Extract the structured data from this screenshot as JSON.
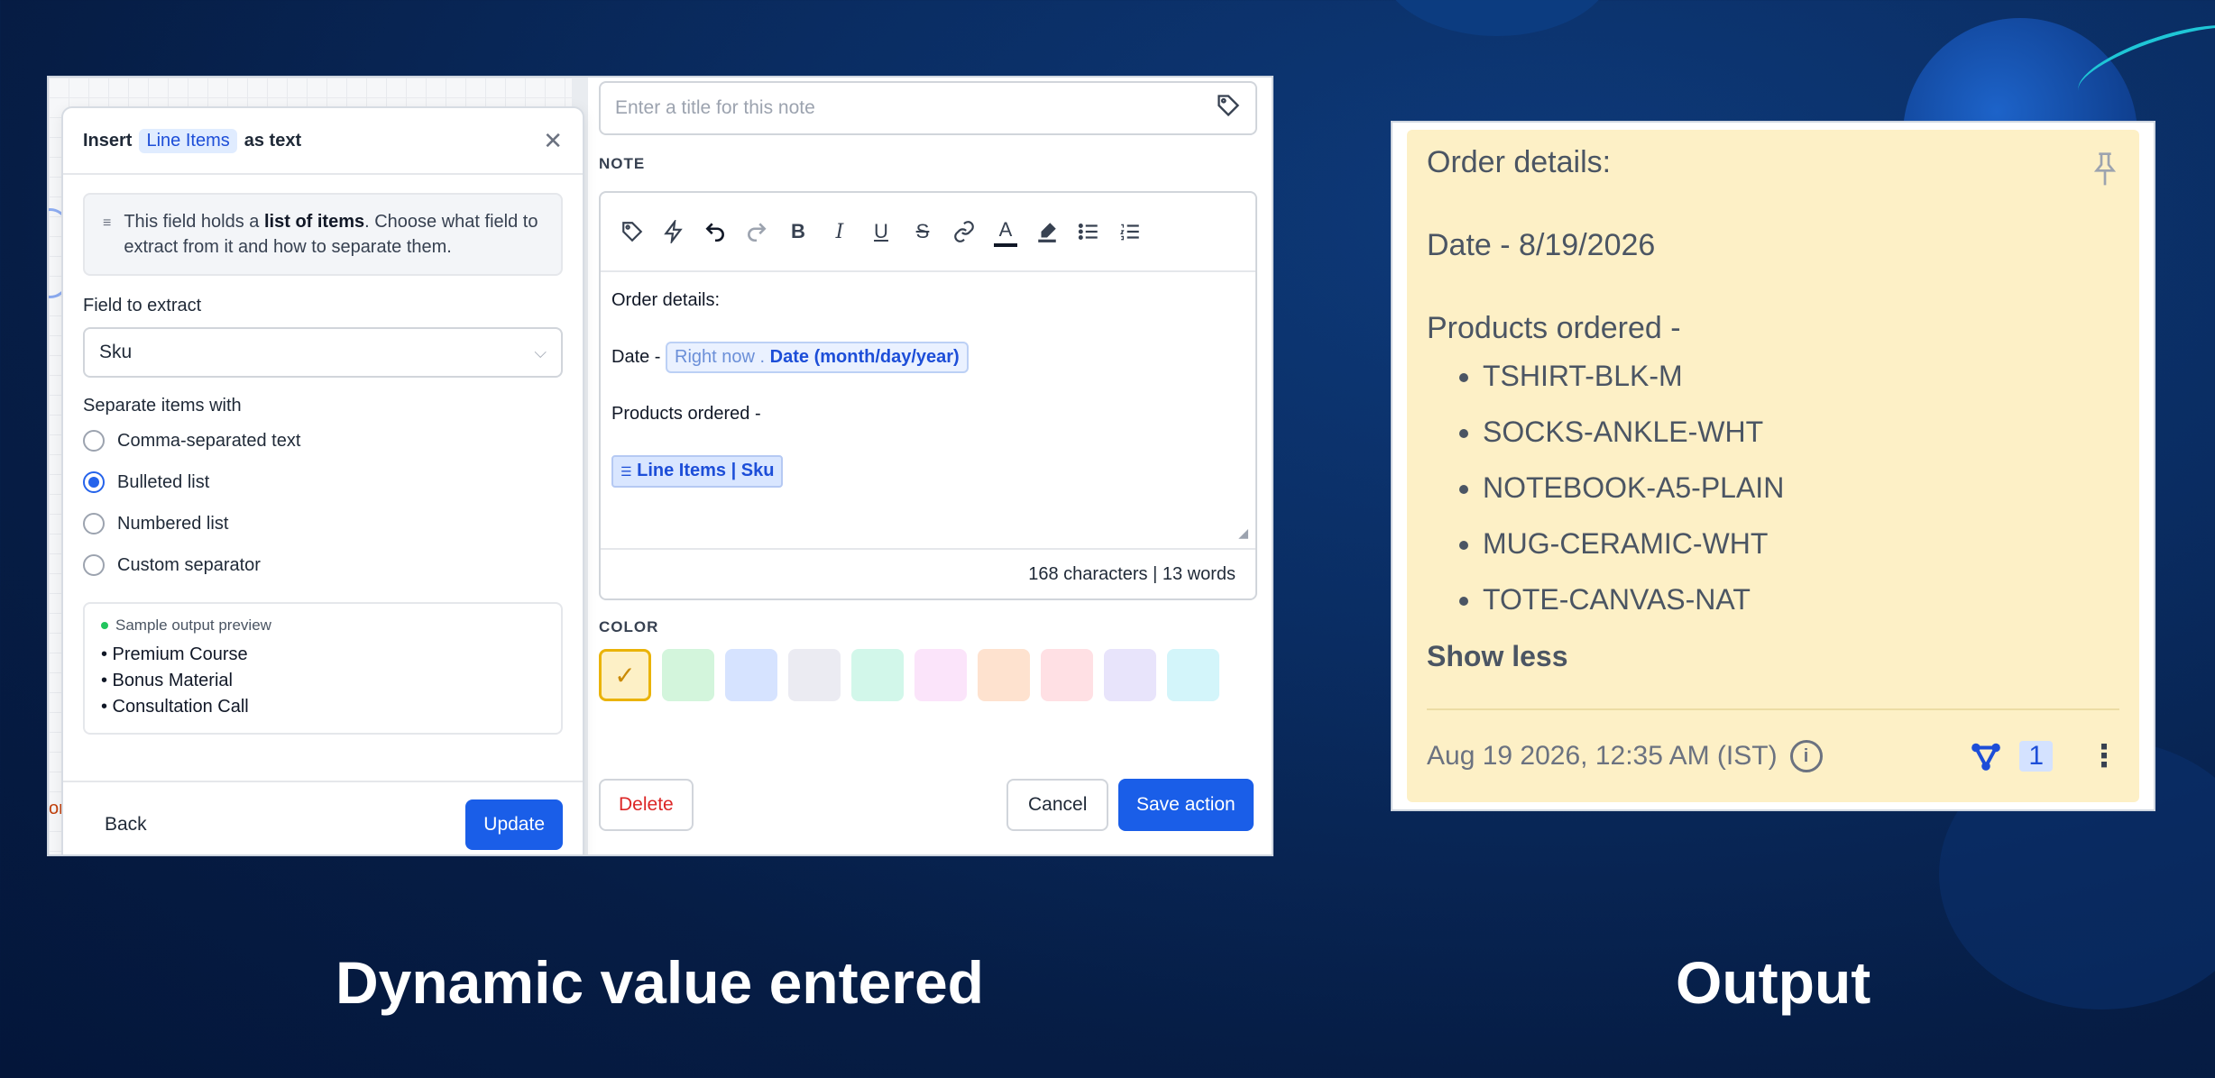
{
  "popup": {
    "title_prefix": "Insert",
    "title_chip": "Line Items",
    "title_suffix": "as text",
    "info_pre": "This field holds a ",
    "info_bold": "list of items",
    "info_post": ". Choose what field to extract from it and how to separate them.",
    "field_label": "Field to extract",
    "field_value": "Sku",
    "separate_label": "Separate items with",
    "options": [
      "Comma-separated text",
      "Bulleted list",
      "Numbered list",
      "Custom separator"
    ],
    "selected_option": 1,
    "preview_title": "Sample output preview",
    "preview_items": [
      "• Premium Course",
      "• Bonus Material",
      "• Consultation Call"
    ],
    "back": "Back",
    "update": "Update"
  },
  "editor": {
    "title_placeholder": "Enter a title for this note",
    "note_label": "NOTE",
    "line1": "Order details:",
    "line2_prefix": "Date - ",
    "chip_source": "Right now",
    "chip_field": "Date (month/day/year)",
    "line3": "Products ordered -",
    "list_chip": "Line Items | Sku",
    "counter": "168 characters | 13 words",
    "color_label": "COLOR",
    "colors": [
      "#fdf0c6",
      "#d3f5dc",
      "#d6e3ff",
      "#ebebf2",
      "#d2f7ea",
      "#fbe4fa",
      "#fee2cf",
      "#ffe0e4",
      "#e8e4fb",
      "#d3f5fa"
    ],
    "delete": "Delete",
    "cancel": "Cancel",
    "save": "Save action"
  },
  "output": {
    "line1": "Order details:",
    "line2": "Date - 8/19/2026",
    "line3": "Products ordered -",
    "items": [
      "TSHIRT-BLK-M",
      "SOCKS-ANKLE-WHT",
      "NOTEBOOK-A5-PLAIN",
      "MUG-CERAMIC-WHT",
      "TOTE-CANVAS-NAT"
    ],
    "show_less": "Show less",
    "timestamp": "Aug 19 2026, 12:35 AM (IST)",
    "workflow_count": "1"
  },
  "captions": {
    "left": "Dynamic value entered",
    "right": "Output"
  }
}
